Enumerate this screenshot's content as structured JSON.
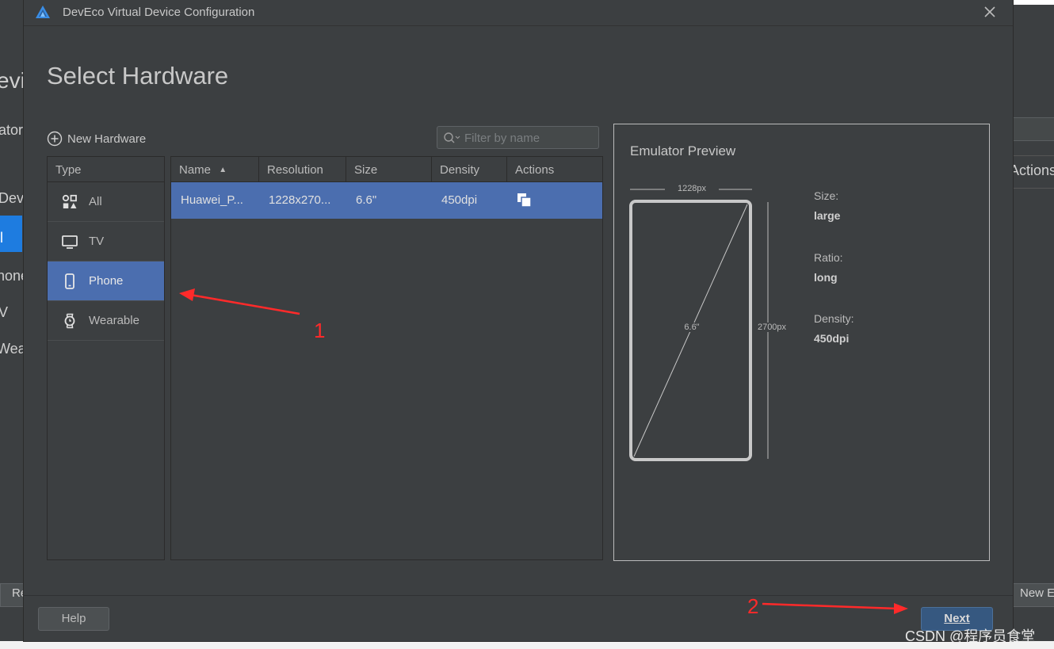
{
  "background": {
    "left_texts": [
      "evic",
      "ator",
      "Devi",
      "l",
      "hone",
      "V",
      "Wear",
      "Re"
    ],
    "right_texts": [
      "Actions",
      "New E"
    ]
  },
  "dialog": {
    "title": "DevEco Virtual Device Configuration",
    "heading": "Select Hardware",
    "new_hardware_label": "New Hardware",
    "filter_placeholder": "Filter by name",
    "type_header": "Type",
    "types": [
      {
        "label": "All",
        "icon": "all-categories-icon",
        "selected": false
      },
      {
        "label": "TV",
        "icon": "tv-icon",
        "selected": false
      },
      {
        "label": "Phone",
        "icon": "phone-icon",
        "selected": true
      },
      {
        "label": "Wearable",
        "icon": "watch-icon",
        "selected": false
      }
    ],
    "table": {
      "columns": [
        "Name",
        "Resolution",
        "Size",
        "Density",
        "Actions"
      ],
      "sort_indicator": "▲",
      "rows": [
        {
          "name": "Huawei_P...",
          "resolution": "1228x270...",
          "size": "6.6\"",
          "density": "450dpi",
          "action_icon": "clone-icon"
        }
      ]
    },
    "preview": {
      "title": "Emulator Preview",
      "width_label": "1228px",
      "height_label": "2700px",
      "diagonal_label": "6.6\"",
      "size_label": "Size:",
      "size_value": "large",
      "ratio_label": "Ratio:",
      "ratio_value": "long",
      "density_label": "Density:",
      "density_value": "450dpi"
    },
    "buttons": {
      "help": "Help",
      "next": "Next"
    }
  },
  "annotations": {
    "marker_1": "1",
    "marker_2": "2",
    "color": "#ff2a2a"
  },
  "watermark": "CSDN @程序员食堂",
  "colors": {
    "selection": "#4b6eaf",
    "background": "#3c3f41",
    "primary_button": "#365880"
  }
}
